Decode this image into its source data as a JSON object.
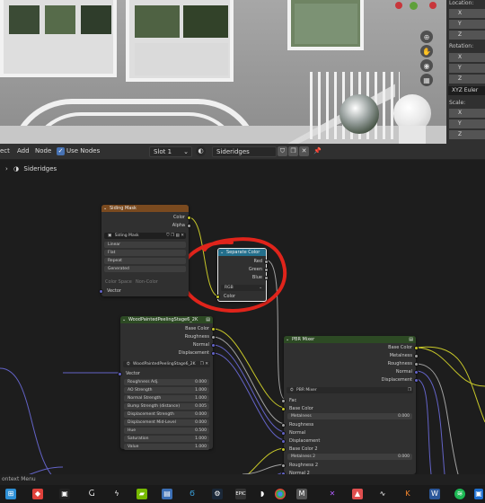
{
  "npanel": {
    "location_label": "Location:",
    "rotation_label": "Rotation:",
    "scale_label": "Scale:",
    "axes": [
      "X",
      "Y",
      "Z"
    ],
    "euler_mode": "XYZ Euler"
  },
  "header": {
    "menu_select": "ect",
    "menu_add": "Add",
    "menu_node": "Node",
    "use_nodes_label": "Use Nodes",
    "slot": "Slot 1",
    "material_name": "Sideridges"
  },
  "breadcrumb": {
    "material": "Sideridges"
  },
  "nodes": {
    "siding_mask": {
      "title": "Siding Mask",
      "out_color": "Color",
      "out_alpha": "Alpha",
      "image_name": "Siding Mask",
      "interpolation": "Linear",
      "projection": "Flat",
      "extension": "Repeat",
      "source": "Generated",
      "color_space_label": "Color Space",
      "color_space_value": "Non-Color",
      "in_vector": "Vector"
    },
    "separate_color": {
      "title": "Separate Color",
      "out_red": "Red",
      "out_green": "Green",
      "out_blue": "Blue",
      "mode": "RGB",
      "in_color": "Color"
    },
    "wood_painted": {
      "title": "WoodPaintedPeelingStage6_2K",
      "out_base_color": "Base Color",
      "out_roughness": "Roughness",
      "out_normal": "Normal",
      "out_displacement": "Displacement",
      "group_name": "WoodPaintedPeelingStage6_2K",
      "in_vector": "Vector",
      "params": [
        {
          "label": "Roughness Adj.",
          "value": "0.000"
        },
        {
          "label": "AO Strength",
          "value": "1.000"
        },
        {
          "label": "Normal Strength",
          "value": "1.000"
        },
        {
          "label": "Bump Strength (distance)",
          "value": "0.005"
        },
        {
          "label": "Displacement Strength",
          "value": "0.000"
        },
        {
          "label": "Displacement Mid-Level",
          "value": "0.000"
        },
        {
          "label": "Hue",
          "value": "0.500"
        },
        {
          "label": "Saturation",
          "value": "1.000"
        },
        {
          "label": "Value",
          "value": "1.000"
        }
      ]
    },
    "pbr_mixer": {
      "title": "PBR Mixer",
      "out_base_color": "Base Color",
      "out_metalness": "Metalness",
      "out_roughness": "Roughness",
      "out_normal": "Normal",
      "out_displacement": "Displacement",
      "group_name": "PBR Mixer",
      "in_fac": "Fac",
      "in_base_color": "Base Color",
      "in_metalness_label": "Metalness",
      "in_metalness_value": "0.000",
      "in_roughness": "Roughness",
      "in_normal": "Normal",
      "in_displacement": "Displacement",
      "in_base_color_2": "Base Color 2",
      "in_metalness2_label": "Metalness 2",
      "in_metalness2_value": "0.000",
      "in_roughness_2": "Roughness 2",
      "in_normal_2": "Normal 2"
    }
  },
  "status": {
    "text": "ontext Menu"
  },
  "colors": {
    "texture_header": "#7a4a1f",
    "converter_header": "#236f8c",
    "group_header": "#2d4a24",
    "socket_color": "#c7c729",
    "socket_float": "#a1a1a1",
    "socket_vector": "#6363c7",
    "annotation": "#e0241b"
  },
  "taskbar_icons": [
    "start-icon",
    "vs-icon",
    "explorer-icon",
    "app-g-icon",
    "app-s-icon",
    "nvidia-icon",
    "explorer2-icon",
    "app-e-icon",
    "steam-icon",
    "epic-icon",
    "app-b-icon",
    "chrome-icon",
    "m-icon",
    "app-x-icon",
    "app-red-icon",
    "app-wave-icon",
    "app-k-icon",
    "word-icon",
    "spotify-icon",
    "app-blue-icon"
  ]
}
